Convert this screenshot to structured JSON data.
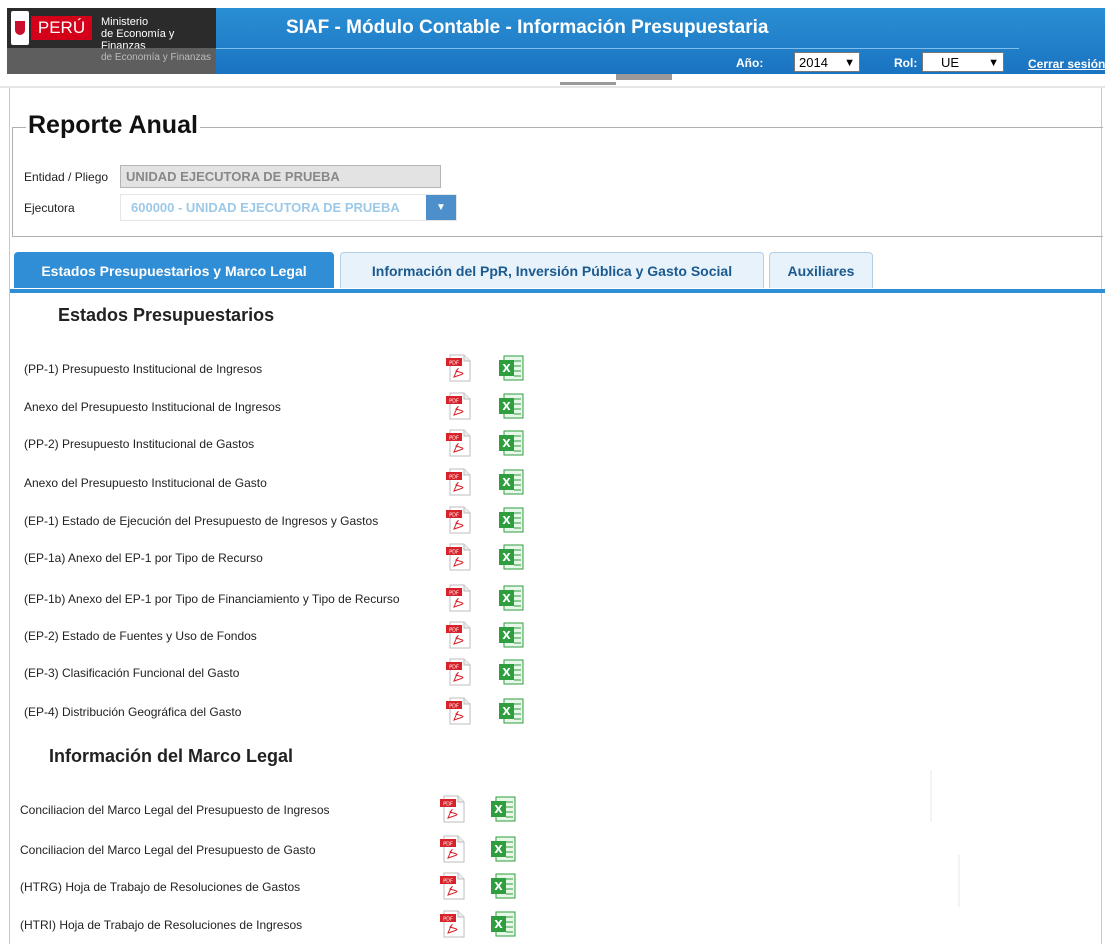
{
  "header": {
    "country": "PERÚ",
    "ministry_line1": "Ministerio",
    "ministry_line2": "de Economía y Finanzas",
    "ministry_ghost": "de Economía y Finanzas",
    "app_title": "SIAF - Módulo Contable - Información Presupuestaria",
    "year_label": "Año:",
    "year_value": "2014",
    "role_label": "Rol:",
    "role_value": "UE",
    "logout": "Cerrar sesión"
  },
  "report": {
    "title": "Reporte Anual",
    "entidad_label": "Entidad / Pliego",
    "entidad_value": "UNIDAD EJECUTORA DE PRUEBA",
    "ejecutora_label": "Ejecutora",
    "ejecutora_value": "600000 - UNIDAD EJECUTORA DE PRUEBA"
  },
  "tabs": [
    {
      "label": "Estados Presupuestarios y Marco Legal",
      "active": true
    },
    {
      "label": "Información del PpR, Inversión Pública y Gasto Social",
      "active": false
    },
    {
      "label": "Auxiliares",
      "active": false
    }
  ],
  "estados": {
    "title": "Estados Presupuestarios",
    "items": [
      "(PP-1) Presupuesto Institucional de Ingresos",
      " Anexo del Presupuesto Institucional de Ingresos",
      "(PP-2) Presupuesto Institucional de Gastos",
      " Anexo del Presupuesto Institucional de Gasto",
      "(EP-1) Estado de Ejecución del Presupuesto de Ingresos y Gastos",
      "(EP-1a) Anexo del EP-1 por Tipo de Recurso",
      "(EP-1b) Anexo del EP-1 por Tipo de Financiamiento y Tipo de Recurso",
      "(EP-2) Estado de Fuentes y Uso de Fondos",
      "(EP-3) Clasificación Funcional del Gasto",
      "(EP-4) Distribución Geográfica del Gasto"
    ]
  },
  "marco": {
    "title": "Información del Marco Legal",
    "items": [
      "Conciliacion del Marco Legal del Presupuesto de Ingresos",
      "Conciliacion del Marco Legal del Presupuesto de Gasto",
      "(HTRG) Hoja de Trabajo de Resoluciones de Gastos",
      "(HTRI) Hoja de Trabajo de Resoluciones de Ingresos"
    ]
  },
  "icons": {
    "pdf": "pdf-file-icon",
    "excel": "excel-file-icon"
  },
  "colors": {
    "header_blue": "#1a73c1",
    "tab_active": "#2f8ed6",
    "pdf_red": "#d8222a",
    "excel_green": "#2e9e3e"
  }
}
